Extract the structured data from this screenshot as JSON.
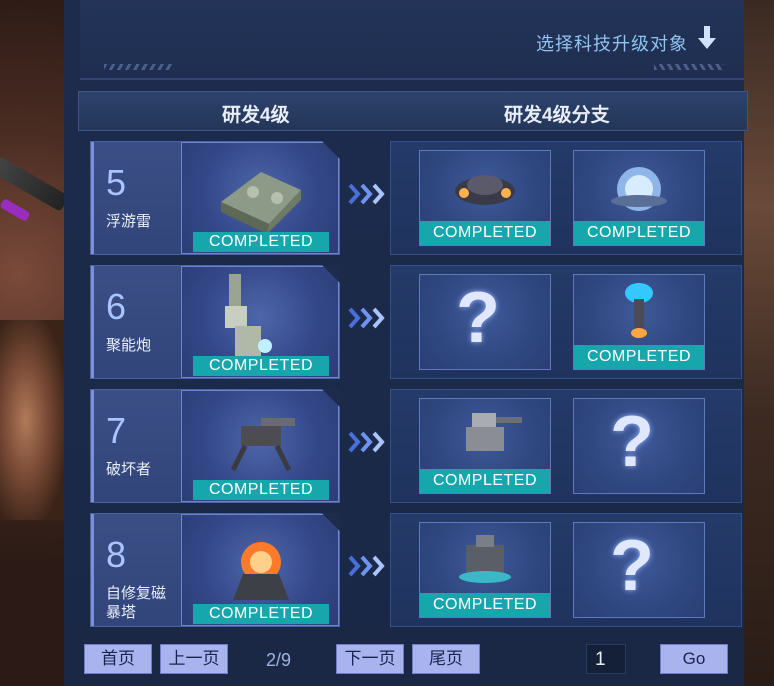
{
  "top": {
    "select_label": "选择科技升级对象"
  },
  "header": {
    "left_title": "研发4级",
    "right_title": "研发4级分支"
  },
  "rows": [
    {
      "number": "5",
      "name": "浮游雷",
      "main_status": "COMPLETED",
      "icon": "floating-mine-icon",
      "branches": [
        {
          "status": "COMPLETED",
          "icon": "branch-drone-icon"
        },
        {
          "status": "COMPLETED",
          "icon": "branch-energy-orb-icon"
        }
      ]
    },
    {
      "number": "6",
      "name": "聚能炮",
      "main_status": "COMPLETED",
      "icon": "energy-cannon-icon",
      "branches": [
        {
          "status": "",
          "icon": "question-mark-icon"
        },
        {
          "status": "COMPLETED",
          "icon": "branch-beacon-icon"
        }
      ]
    },
    {
      "number": "7",
      "name": "破坏者",
      "main_status": "COMPLETED",
      "icon": "destroyer-mech-icon",
      "branches": [
        {
          "status": "COMPLETED",
          "icon": "branch-turret-icon"
        },
        {
          "status": "",
          "icon": "question-mark-icon"
        }
      ]
    },
    {
      "number": "8",
      "name": "自修复磁暴塔",
      "main_status": "COMPLETED",
      "icon": "magnetic-tower-icon",
      "branches": [
        {
          "status": "COMPLETED",
          "icon": "branch-reactor-icon"
        },
        {
          "status": "",
          "icon": "question-mark-icon"
        }
      ]
    }
  ],
  "pagination": {
    "first": "首页",
    "prev": "上一页",
    "page_info": "2/9",
    "next": "下一页",
    "last": "尾页",
    "input_value": "1",
    "go": "Go"
  }
}
